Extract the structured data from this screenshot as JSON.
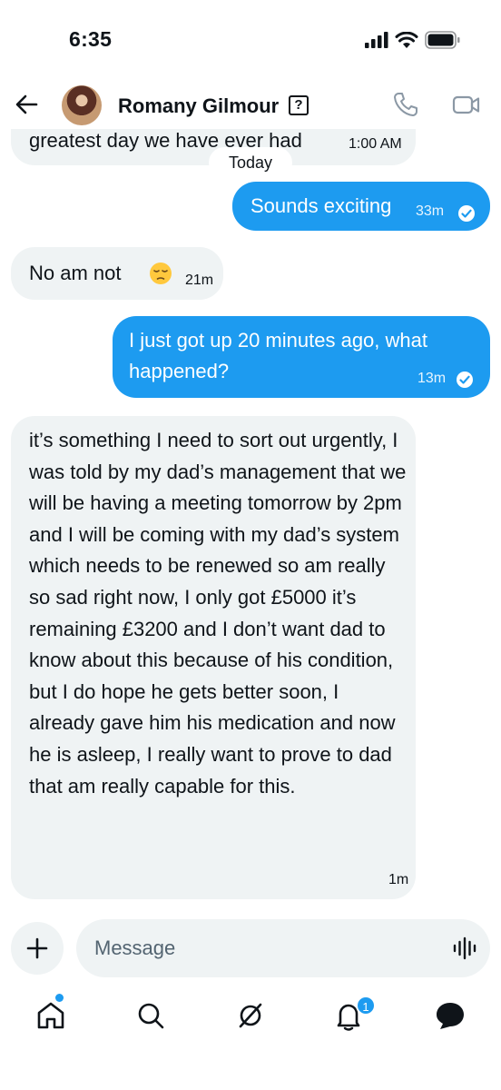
{
  "status_bar": {
    "time": "6:35"
  },
  "header": {
    "contact_name": "Romany Gilmour",
    "help_badge": "?",
    "icons": [
      "back-arrow-icon",
      "phone-icon",
      "video-icon"
    ]
  },
  "day_divider": "Today",
  "messages": [
    {
      "direction": "in",
      "text": "greatest day we have ever had",
      "time": "1:00 AM"
    },
    {
      "direction": "out",
      "text": "Sounds exciting",
      "time": "33m",
      "read": true
    },
    {
      "direction": "in",
      "text": "No am not",
      "emoji": "😔",
      "time": "21m"
    },
    {
      "direction": "out",
      "text": "I just got up 20 minutes ago, what happened?",
      "time": "13m",
      "read": true
    },
    {
      "direction": "in",
      "text": "it’s something I need to sort out urgently, I was told by my dad’s management that we will be having a meeting tomorrow by 2pm and I will be coming with my dad’s system which needs to be renewed so am really so sad right now, I only got £5000 it’s remaining £3200 and I don’t want dad to know about this because of his condition, but I do hope he gets better soon, I already gave him his medication and now he is asleep, I really want to prove to dad that am really capable for this.",
      "time": "1m"
    }
  ],
  "composer": {
    "placeholder": "Message"
  },
  "bottom_nav": {
    "items": [
      "home-icon",
      "search-icon",
      "grok-icon",
      "notifications-icon",
      "messages-icon"
    ],
    "notification_count": "1"
  },
  "colors": {
    "accent": "#1d9bf0",
    "bubble_in": "#eff3f4",
    "text": "#0f1419",
    "muted": "#536471"
  }
}
